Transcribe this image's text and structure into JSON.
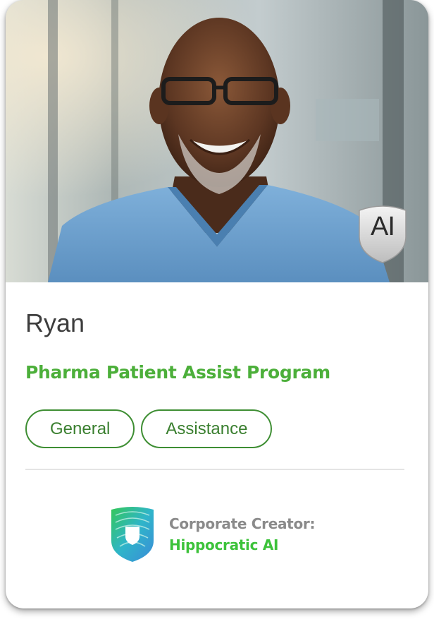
{
  "profile": {
    "name": "Ryan",
    "program": "Pharma Patient Assist Program",
    "badge": "AI",
    "photo_icon": "person-portrait-photo"
  },
  "tags": [
    {
      "label": "General"
    },
    {
      "label": "Assistance"
    }
  ],
  "creator": {
    "label": "Corporate Creator:",
    "name": "Hippocratic AI",
    "logo_icon": "shield-logo-icon"
  },
  "colors": {
    "accent_green": "#4caf3a",
    "creator_green": "#3cc23a",
    "tag_border": "#3e8e33",
    "scrubs_blue": "#6fa3cf"
  }
}
